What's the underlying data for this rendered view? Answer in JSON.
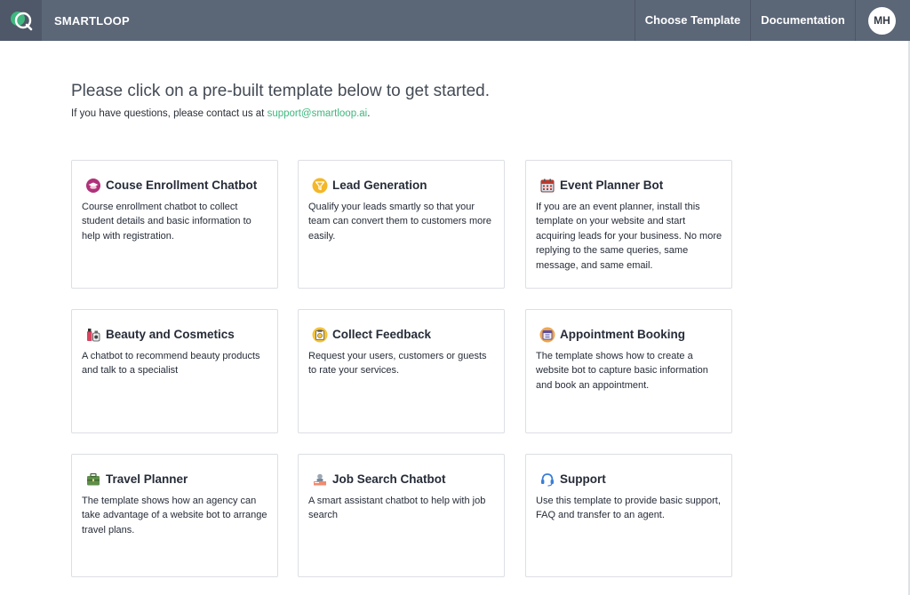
{
  "header": {
    "brand": "SMARTLOOP",
    "nav": {
      "choose_template": "Choose Template",
      "documentation": "Documentation"
    },
    "avatar_initials": "MH"
  },
  "main": {
    "heading": "Please click on a pre-built template below to get started.",
    "subheading_prefix": "If you have questions, please contact us at ",
    "support_email": "support@smartloop.ai",
    "subheading_suffix": "."
  },
  "templates": [
    {
      "title": "Couse Enrollment Chatbot",
      "description": "Course enrollment chatbot to collect student details and basic information to help with registration.",
      "icon": "graduation-cap-icon"
    },
    {
      "title": "Lead Generation",
      "description": "Qualify your leads smartly so that your team can convert them to customers more easily.",
      "icon": "funnel-icon"
    },
    {
      "title": "Event Planner Bot",
      "description": "If you are an event planner, install this template on your website and start acquiring leads for your business. No more replying to the same queries, same message, and same email.",
      "icon": "calendar-icon"
    },
    {
      "title": "Beauty and Cosmetics",
      "description": "A chatbot to recommend beauty products and talk to a specialist",
      "icon": "cosmetics-icon"
    },
    {
      "title": "Collect Feedback",
      "description": "Request your users, customers or guests to rate your services.",
      "icon": "feedback-icon"
    },
    {
      "title": "Appointment Booking",
      "description": "The template shows how to create a website bot to capture basic information and book an appointment.",
      "icon": "appointment-icon"
    },
    {
      "title": "Travel Planner",
      "description": "The template shows how an agency can take advantage of a website bot to arrange travel plans.",
      "icon": "suitcase-icon"
    },
    {
      "title": "Job Search Chatbot",
      "description": "A smart assistant chatbot to help with job search",
      "icon": "job-desk-icon"
    },
    {
      "title": "Support",
      "description": "Use this template to provide basic support, FAQ and transfer to an agent.",
      "icon": "headset-icon"
    }
  ],
  "colors": {
    "topbar": "#5b6677",
    "link": "#3fb77e"
  }
}
